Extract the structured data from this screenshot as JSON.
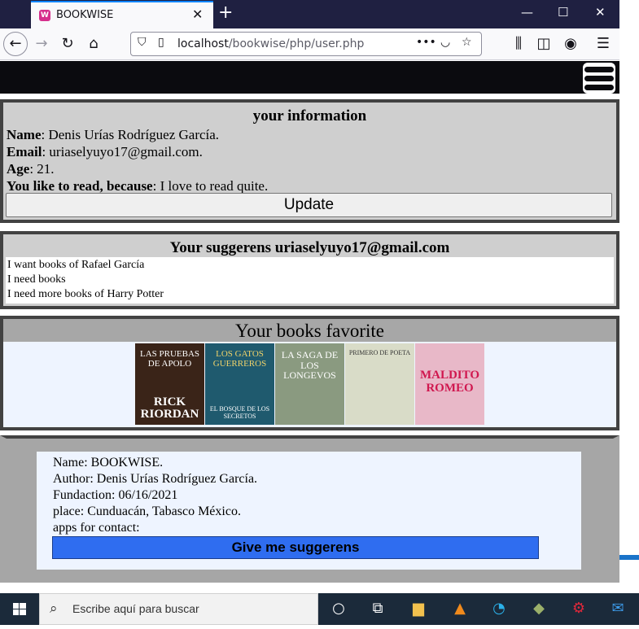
{
  "browser": {
    "tab_title": "BOOKWISE",
    "favicon_letter": "W",
    "url_host": "localhost",
    "url_path": "/bookwise/php/user.php"
  },
  "user_info": {
    "title": "your information",
    "name_label": "Name",
    "name_value": ": Denis Urías Rodríguez García.",
    "email_label": "Email",
    "email_value": ": uriaselyuyo17@gmail.com.",
    "age_label": "Age",
    "age_value": ": 21.",
    "reason_label": "You like to read, because",
    "reason_value": ": I love to read quite.",
    "update_label": "Update"
  },
  "suggestions": {
    "title": "Your suggerens uriaselyuyo17@gmail.com",
    "items": [
      "I want books of Rafael García",
      "I need books",
      "I need more books of Harry Potter"
    ]
  },
  "favorites": {
    "title": "Your books favorite",
    "books": [
      {
        "top": "LAS PRUEBAS DE APOLO",
        "bottom": "RICK RIORDAN",
        "color": "#3a2418"
      },
      {
        "top": "LOS GATOS GUERREROS",
        "bottom": "EL BOSQUE DE LOS SECRETOS",
        "color": "#1f5a6e"
      },
      {
        "top": "LA SAGA DE LOS LONGEVOS",
        "bottom": "",
        "color": "#8a9a80"
      },
      {
        "top": "PRIMERO DE POETA",
        "bottom": "",
        "color": "#d9dcc8"
      },
      {
        "top": "MALDITO ROMEO",
        "bottom": "",
        "color": "#e8b8c8"
      }
    ]
  },
  "footer": {
    "name": "Name: BOOKWISE.",
    "author": "Author: Denis Urías Rodríguez García.",
    "fundaction": "Fundaction: 06/16/2021",
    "place": "place: Cunduacán, Tabasco México.",
    "apps": "apps for contact:",
    "give_label": "Give me suggerens"
  },
  "taskbar": {
    "search_placeholder": "Escribe aquí para buscar"
  }
}
